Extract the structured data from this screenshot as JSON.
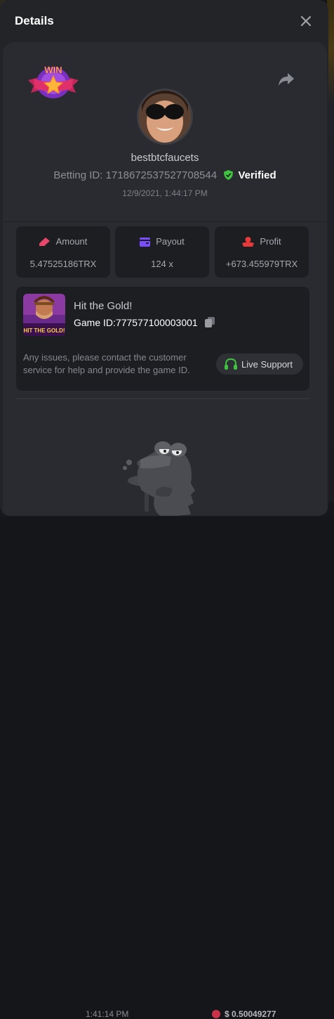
{
  "background": {
    "time": "1:41:14 PM",
    "amount": "$ 0.50049277"
  },
  "modal": {
    "title": "Details",
    "badge_text": "WIN"
  },
  "bet": {
    "username": "bestbtcfaucets",
    "betting_id_label": "Betting ID:",
    "betting_id": "1718672537527708544",
    "verified": "Verified",
    "timestamp": "12/9/2021, 1:44:17 PM"
  },
  "stats": [
    {
      "label": "Amount",
      "value": "5.47525186TRX",
      "icon": "amount-icon"
    },
    {
      "label": "Payout",
      "value": "124 x",
      "icon": "wallet-icon"
    },
    {
      "label": "Profit",
      "value": "+673.455979TRX",
      "icon": "profit-icon"
    }
  ],
  "game": {
    "name": "Hit the Gold!",
    "thumb_text": "HIT THE GOLD!",
    "id_label": "Game ID:",
    "id": "777577100003001",
    "support_note": "Any issues, please contact the customer service for help and provide the game ID.",
    "support_button": "Live Support"
  },
  "colors": {
    "accent_green": "#3ec43e",
    "amount_icon": "#e8466a",
    "payout_icon": "#7a4dff",
    "profit_icon": "#e83a3a"
  }
}
